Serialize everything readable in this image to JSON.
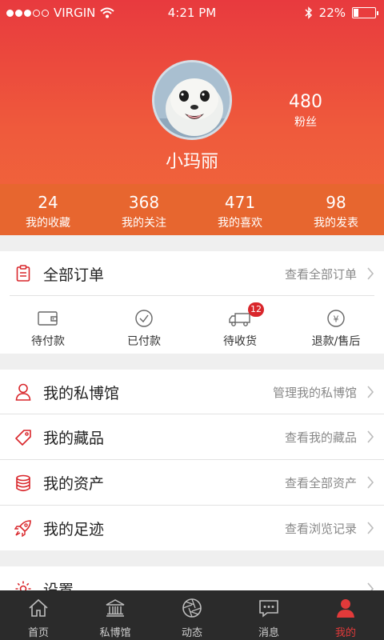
{
  "status_bar": {
    "carrier": "VIRGIN",
    "time": "4:21 PM",
    "battery": "22%",
    "battery_level": 0.22
  },
  "profile": {
    "name": "小玛丽",
    "fans_count": "480",
    "fans_label": "粉丝"
  },
  "stats": [
    {
      "value": "24",
      "label": "我的收藏"
    },
    {
      "value": "368",
      "label": "我的关注"
    },
    {
      "value": "471",
      "label": "我的喜欢"
    },
    {
      "value": "98",
      "label": "我的发表"
    }
  ],
  "orders": {
    "title": "全部订单",
    "more": "查看全部订单",
    "items": [
      {
        "label": "待付款",
        "icon": "wallet-icon"
      },
      {
        "label": "已付款",
        "icon": "check-circle-icon"
      },
      {
        "label": "待收货",
        "icon": "truck-icon",
        "badge": "12"
      },
      {
        "label": "退款/售后",
        "icon": "yuan-circle-icon"
      }
    ]
  },
  "menu": [
    {
      "title": "我的私博馆",
      "more": "管理我的私博馆",
      "icon": "person-icon"
    },
    {
      "title": "我的藏品",
      "more": "查看我的藏品",
      "icon": "tag-icon"
    },
    {
      "title": "我的资产",
      "more": "查看全部资产",
      "icon": "database-icon"
    },
    {
      "title": "我的足迹",
      "more": "查看浏览记录",
      "icon": "rocket-icon"
    }
  ],
  "settings": {
    "title": "设置",
    "icon": "gear-icon"
  },
  "tabbar": [
    {
      "label": "首页",
      "icon": "home-icon"
    },
    {
      "label": "私博馆",
      "icon": "museum-icon"
    },
    {
      "label": "动态",
      "icon": "aperture-icon"
    },
    {
      "label": "消息",
      "icon": "message-icon"
    },
    {
      "label": "我的",
      "icon": "user-icon",
      "active": true
    }
  ],
  "colors": {
    "accent": "#d9262b",
    "header_top": "#e83a3e",
    "stats_bar": "#e7662f",
    "tabbar": "#2b2b2b"
  }
}
